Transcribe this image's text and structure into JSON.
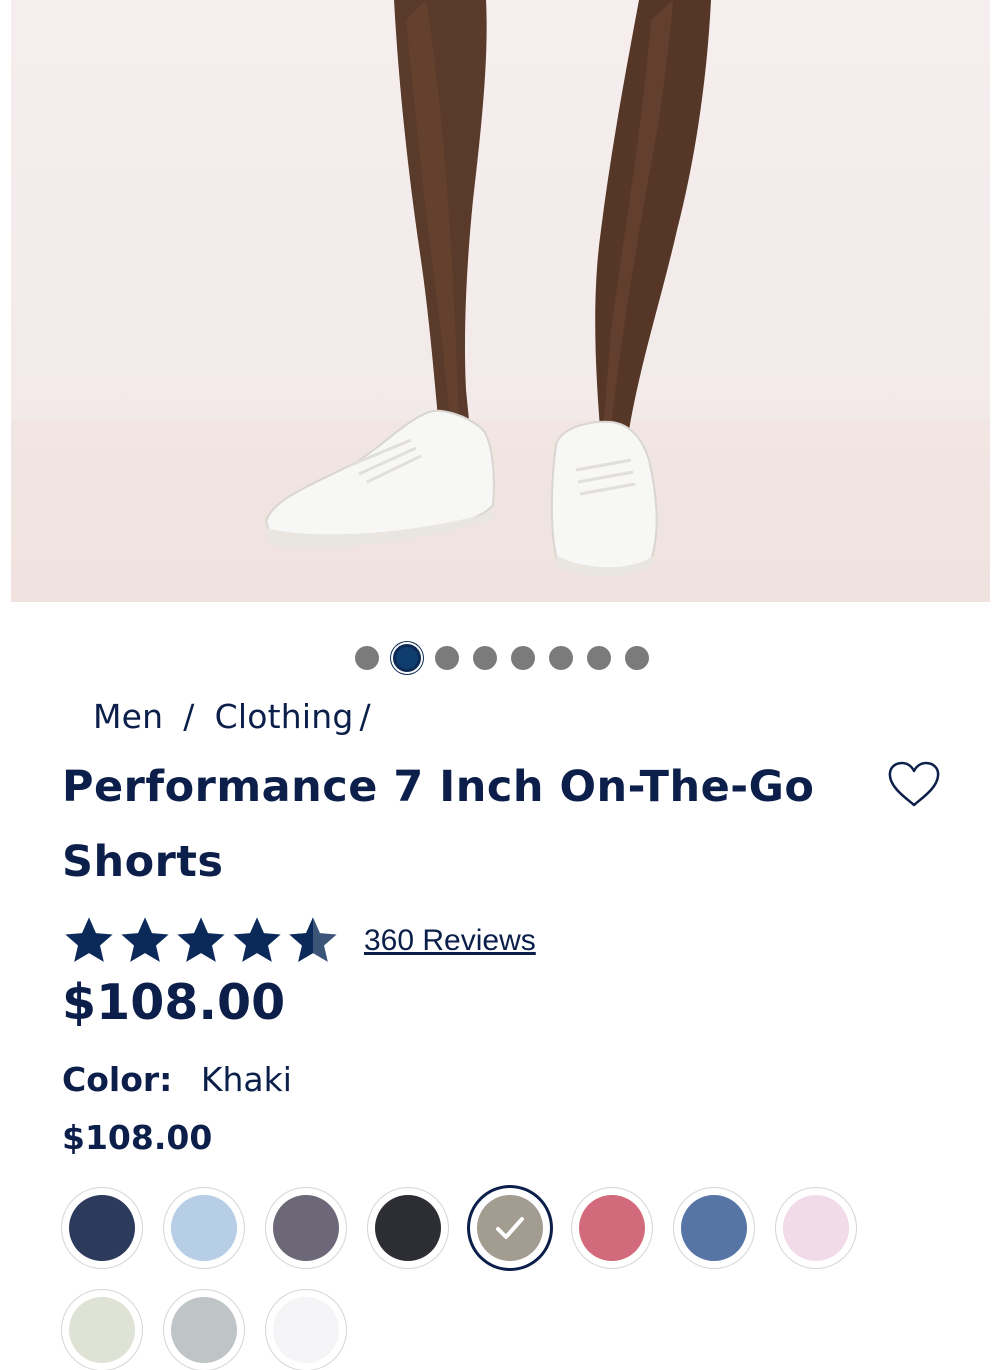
{
  "product": {
    "image_alt": "Model wearing shorts and white sneakers",
    "carousel": {
      "count": 8,
      "active_index": 1
    },
    "breadcrumb": {
      "items": [
        "Men",
        "Clothing"
      ],
      "sep": "/",
      "trailing_sep": "/"
    },
    "title_line1": "Performance 7 Inch On-The-Go",
    "title_line2": "Shorts",
    "rating": {
      "value": 4.5,
      "max": 5,
      "reviews_label": "360 Reviews"
    },
    "price": "$108.00",
    "color_label": "Color:",
    "color_value": "Khaki",
    "selected_price": "$108.00",
    "swatches": [
      {
        "name": "Navy",
        "color": "#2c3a5c",
        "selected": false
      },
      {
        "name": "Light Blue",
        "color": "#b7cfe6",
        "selected": false
      },
      {
        "name": "Charcoal Purple",
        "color": "#6d6878",
        "selected": false
      },
      {
        "name": "Black",
        "color": "#2c2e34",
        "selected": false
      },
      {
        "name": "Khaki",
        "color": "#a39c91",
        "selected": true
      },
      {
        "name": "Pink Red",
        "color": "#d36a7b",
        "selected": false
      },
      {
        "name": "Blue",
        "color": "#5774a7",
        "selected": false
      },
      {
        "name": "Light Pink",
        "color": "#f1dbe9",
        "selected": false
      },
      {
        "name": "Sage",
        "color": "#dfe3d5",
        "selected": false
      },
      {
        "name": "Grey",
        "color": "#bfc4c7",
        "selected": false
      },
      {
        "name": "White",
        "color": "#f5f5f8",
        "selected": false
      }
    ]
  },
  "colors": {
    "brand_navy": "#0b1f4a",
    "dot_inactive": "#7b7b7b",
    "dot_active": "#0f3d6e"
  }
}
